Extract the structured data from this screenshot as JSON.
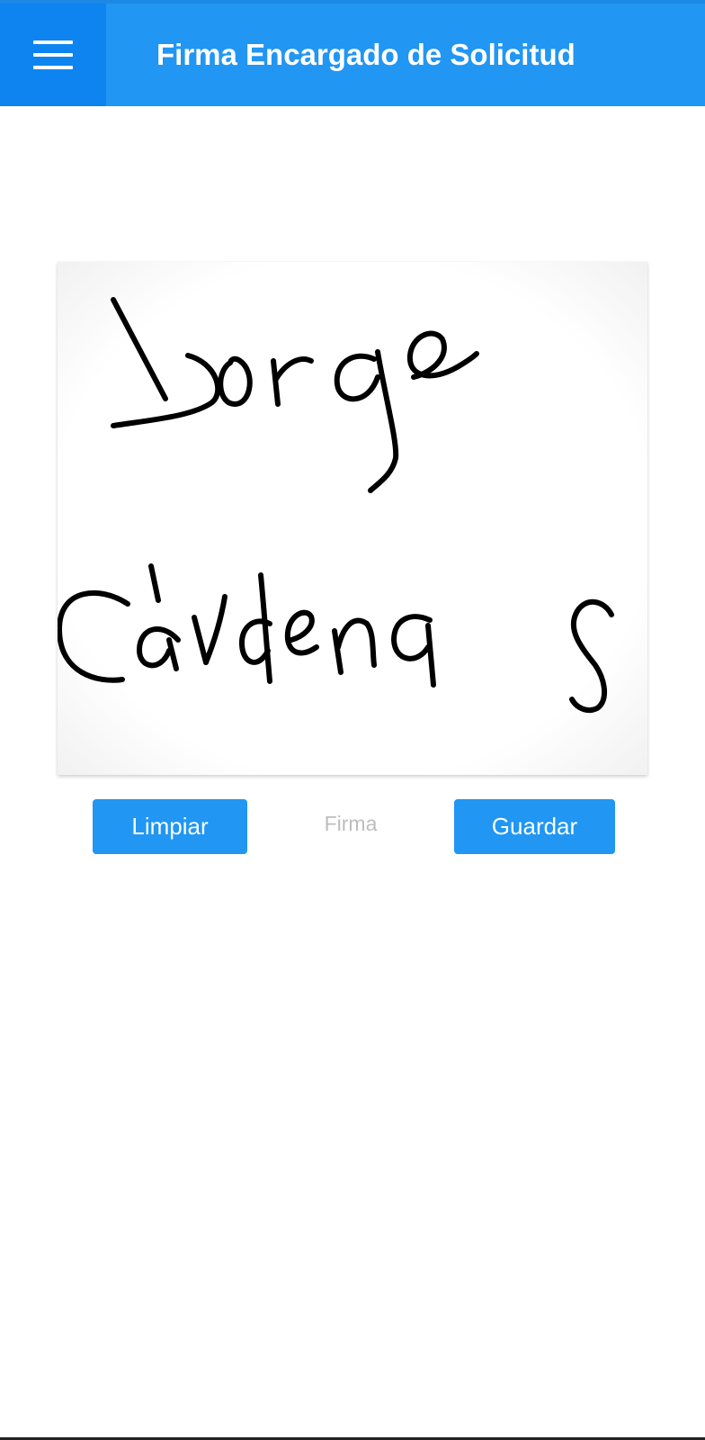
{
  "app_bar": {
    "title": "Firma Encargado de Solicitud",
    "menu_icon": "hamburger-menu-icon",
    "color": "#2196f3"
  },
  "signature_pad": {
    "signature_text": "Jorge Cardenas",
    "stroke_color": "#000000",
    "background": "#ffffff"
  },
  "actions": {
    "clear_label": "Limpiar",
    "caption": "Firma",
    "save_label": "Guardar",
    "button_color": "#2196f3"
  }
}
